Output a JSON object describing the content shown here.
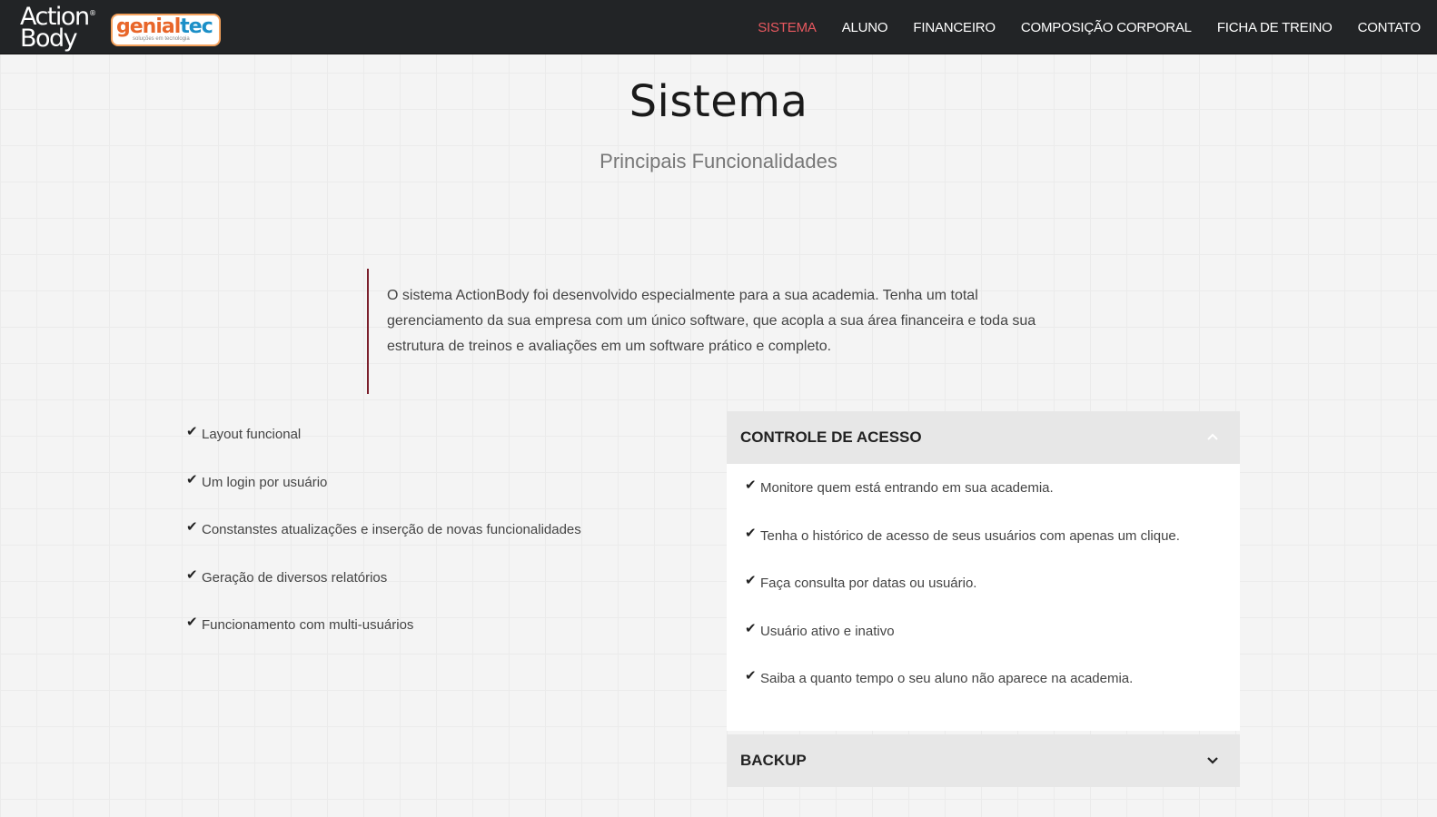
{
  "header": {
    "logo_action_line1": "Action",
    "logo_action_line2": "Body",
    "logo_genial_part1": "genial",
    "logo_genial_part2": "tec",
    "logo_genial_tagline": "soluções em tecnologia",
    "nav": [
      {
        "label": "SISTEMA",
        "active": true
      },
      {
        "label": "ALUNO"
      },
      {
        "label": "FINANCEIRO"
      },
      {
        "label": "COMPOSIÇÃO CORPORAL"
      },
      {
        "label": "FICHA DE TREINO"
      },
      {
        "label": "CONTATO"
      }
    ]
  },
  "main": {
    "title": "Sistema",
    "subtitle": "Principais Funcionalidades",
    "intro": "O sistema ActionBody foi desenvolvido especialmente para a sua academia. Tenha um total gerenciamento da sua empresa com um único software, que acopla a sua área financeira e toda sua estrutura de treinos e avaliações em um software prático e completo.",
    "features": [
      "Layout funcional",
      "Um login por usuário",
      "Constanstes atualizações e inserção de novas funcionalidades",
      "Geração de diversos relatórios",
      "Funcionamento com multi-usuários"
    ],
    "accordion": [
      {
        "title": "CONTROLE DE ACESSO",
        "expanded": true,
        "items": [
          "Monitore quem está entrando em sua academia.",
          "Tenha o histórico de acesso de seus usuários com apenas um clique.",
          "Faça consulta por datas ou usuário.",
          "Usuário ativo e inativo",
          "Saiba a quanto tempo o seu aluno não aparece na academia."
        ]
      },
      {
        "title": "BACKUP",
        "expanded": false
      }
    ]
  },
  "colors": {
    "navbar_bg": "#222426",
    "nav_active": "#e8585f",
    "quote_border": "#7a1f2b",
    "accordion_head_bg": "#e7e7e7"
  },
  "icons": {
    "check": "check-icon",
    "chevron_up": "chevron-up-icon",
    "chevron_down": "chevron-down-icon"
  }
}
